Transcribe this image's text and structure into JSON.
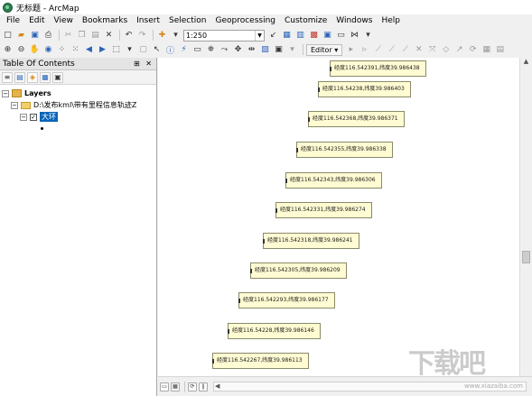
{
  "window": {
    "title": "无标题 - ArcMap"
  },
  "menu": [
    "File",
    "Edit",
    "View",
    "Bookmarks",
    "Insert",
    "Selection",
    "Geoprocessing",
    "Customize",
    "Windows",
    "Help"
  ],
  "toolbar": {
    "scale_value": "1:250",
    "editor_label": "Editor ▾"
  },
  "toc": {
    "title": "Table Of Contents",
    "controls": "⊞ ✕",
    "root_label": "Layers",
    "folder_label": "D:\\发布kml\\带有里程信息轨迹Z",
    "layer_label": "大环"
  },
  "map": {
    "labels": [
      "经度116.542391,纬度39.986438",
      "经度116.54238,纬度39.986403",
      "经度116.542368,纬度39.986371",
      "经度116.542355,纬度39.986338",
      "经度116.542343,纬度39.986306",
      "经度116.542331,纬度39.986274",
      "经度116.542318,纬度39.986241",
      "经度116.542305,纬度39.986209",
      "经度116.542293,纬度39.986177",
      "经度116.54228,纬度39.986146",
      "经度116.542267,纬度39.986113"
    ]
  },
  "watermark": {
    "text": "下载吧",
    "url": "www.xiazaiba.com"
  },
  "colors": {
    "label_fill": "#fffbd2",
    "selection": "#0a64b8"
  }
}
